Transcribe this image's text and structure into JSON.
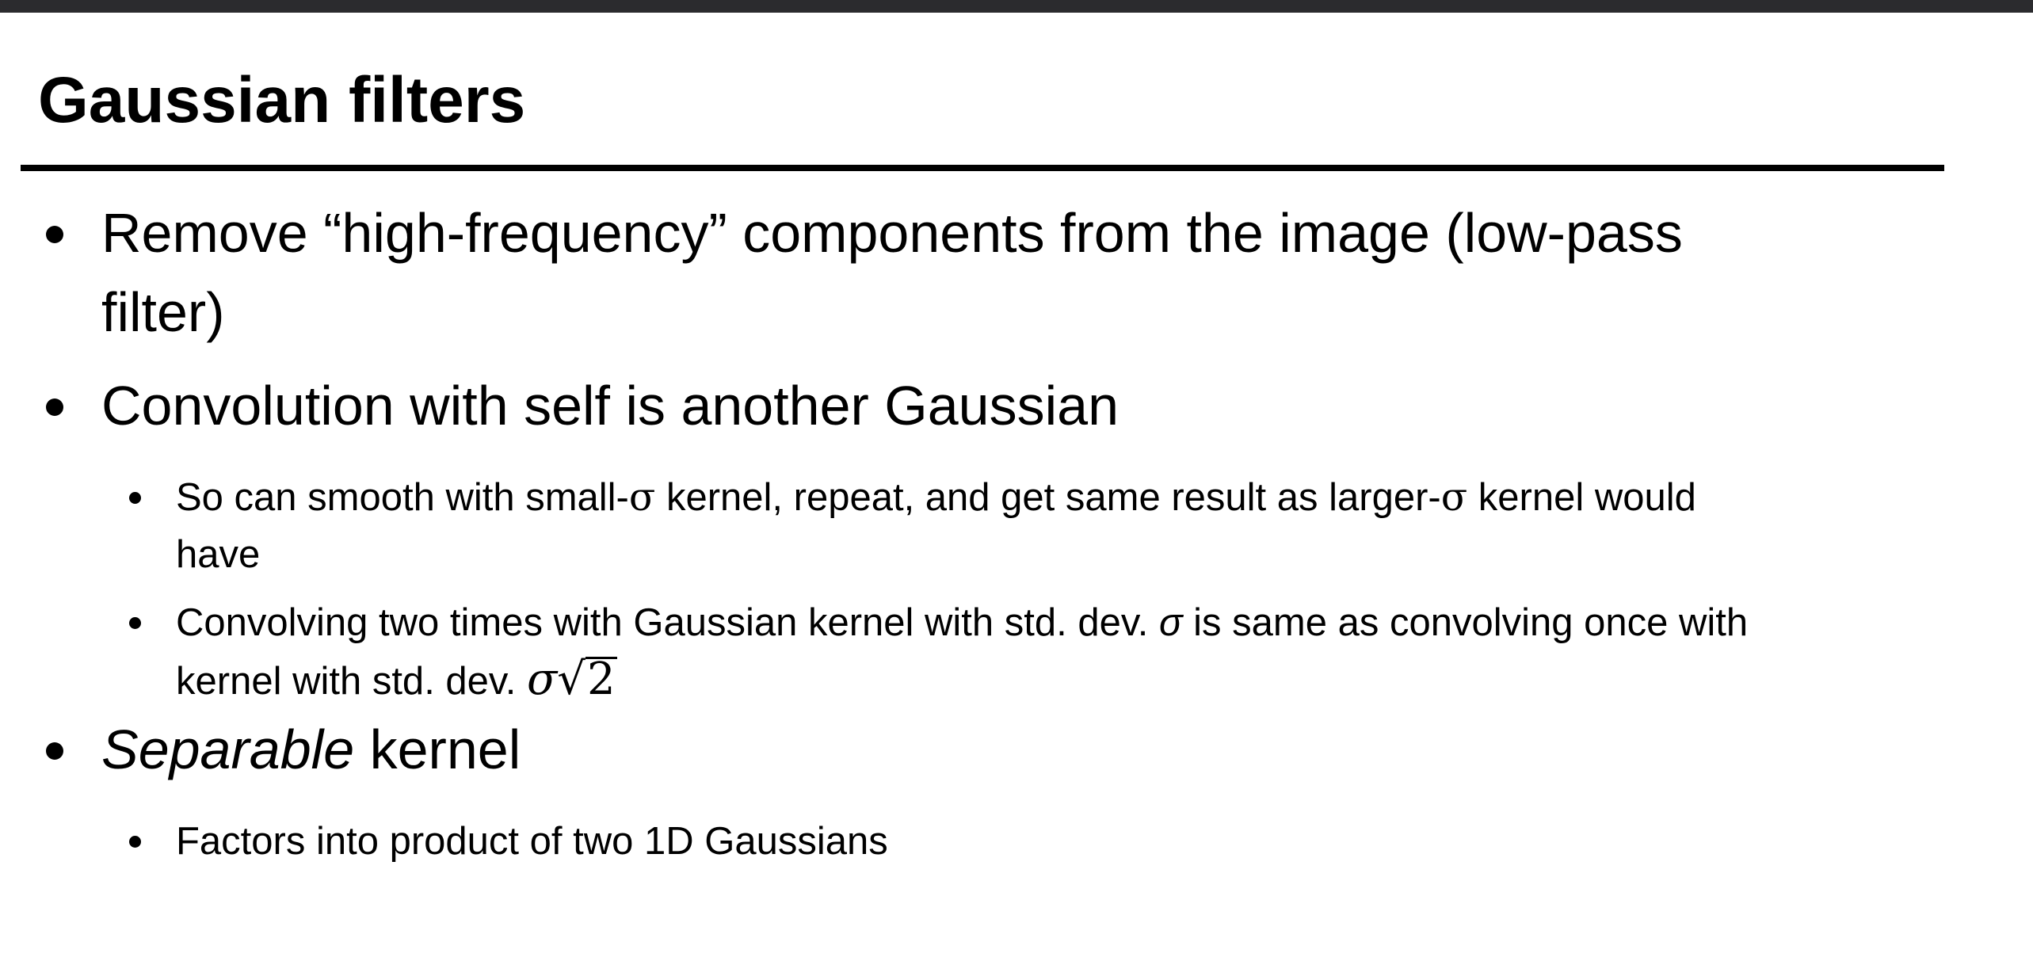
{
  "slide": {
    "title": "Gaussian filters",
    "bullets": [
      {
        "line1": "Remove “high-frequency” components from the image (low-pass",
        "line2": "filter)"
      },
      {
        "text": "Convolution with self is another Gaussian",
        "sub": [
          {
            "part1": "So can smooth with small-",
            "sym1": "σ",
            "part2": " kernel, repeat, and get same result as larger-",
            "sym2": "σ",
            "part3": " kernel would",
            "line2": "have"
          },
          {
            "part1": "Convolving two times with Gaussian kernel with std. dev. ",
            "sym1": "σ",
            "part2": " is same as convolving once with",
            "line2_text": "kernel with std. dev. ",
            "math_sigma": "σ",
            "math_radical": "√",
            "math_radicand": "2"
          }
        ]
      },
      {
        "italic": "Separable",
        "rest": " kernel",
        "sub": [
          {
            "text": "Factors into product of two 1D Gaussians"
          }
        ]
      }
    ]
  }
}
